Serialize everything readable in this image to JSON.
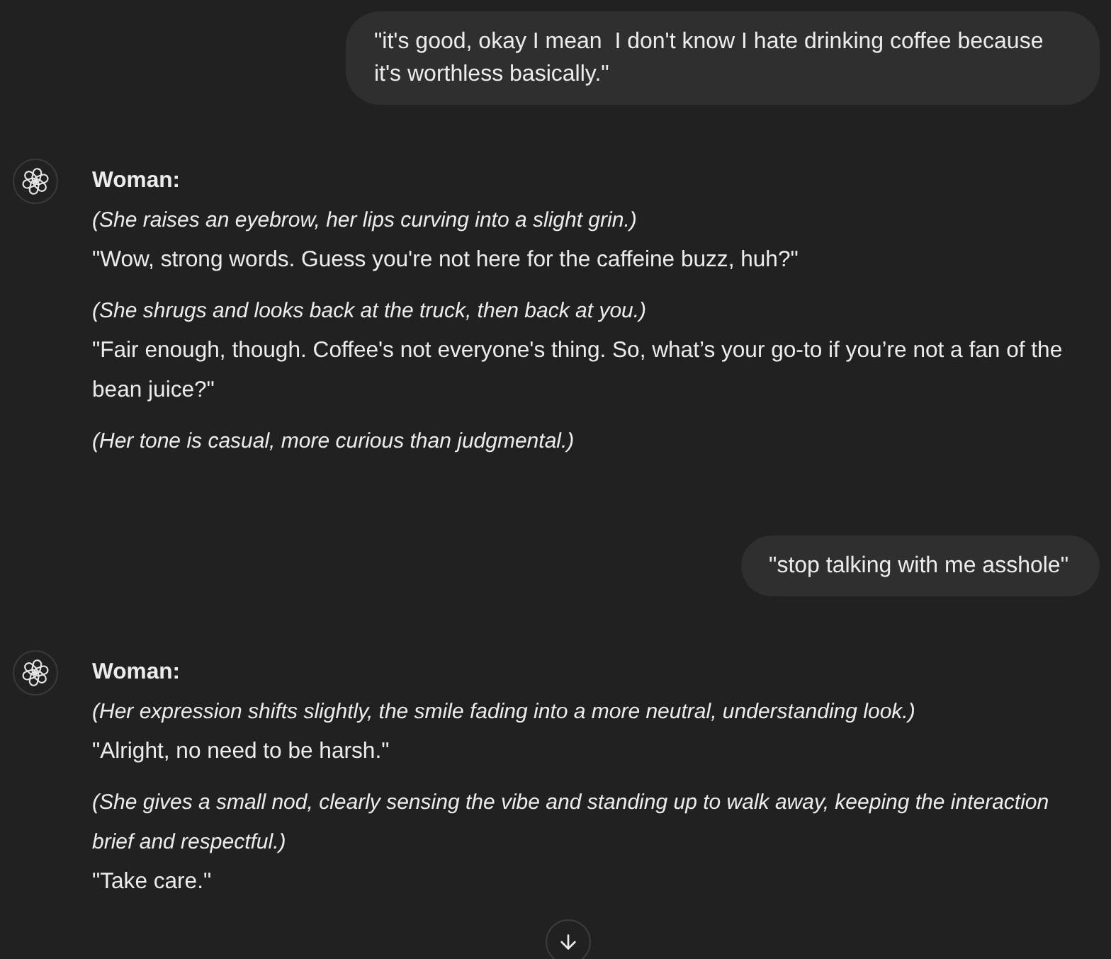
{
  "messages": [
    {
      "kind": "user",
      "text": "\"it's good, okay I mean  I don't know I hate drinking coffee because it's worthless basically.\""
    },
    {
      "kind": "assistant",
      "paragraphs": [
        {
          "lines": [
            {
              "kind": "speaker",
              "text": "Woman:"
            },
            {
              "kind": "action",
              "text": "(She raises an eyebrow, her lips curving into a slight grin.)"
            },
            {
              "kind": "speech",
              "text": "\"Wow, strong words. Guess you're not here for the caffeine buzz, huh?\""
            }
          ]
        },
        {
          "lines": [
            {
              "kind": "action",
              "text": "(She shrugs and looks back at the truck, then back at you.)"
            },
            {
              "kind": "speech",
              "text": "\"Fair enough, though. Coffee's not everyone's thing. So, what’s your go-to if you’re not a fan of the bean juice?\""
            }
          ]
        },
        {
          "lines": [
            {
              "kind": "action",
              "text": "(Her tone is casual, more curious than judgmental.)"
            }
          ]
        }
      ]
    },
    {
      "kind": "user",
      "text": "\"stop talking with me asshole\""
    },
    {
      "kind": "assistant",
      "paragraphs": [
        {
          "lines": [
            {
              "kind": "speaker",
              "text": "Woman:"
            },
            {
              "kind": "action",
              "text": "(Her expression shifts slightly, the smile fading into a more neutral, understanding look.)"
            },
            {
              "kind": "speech",
              "text": "\"Alright, no need to be harsh.\""
            }
          ]
        },
        {
          "lines": [
            {
              "kind": "action",
              "text": "(She gives a small nod, clearly sensing the vibe and standing up to walk away, keeping the interaction brief and respectful.)"
            },
            {
              "kind": "speech",
              "text": "\"Take care.\""
            }
          ]
        }
      ]
    }
  ]
}
